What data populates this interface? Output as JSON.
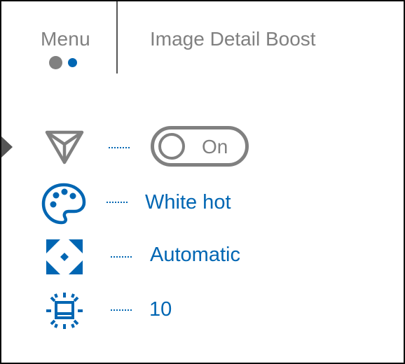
{
  "header": {
    "menu_label": "Menu",
    "title": "Image Detail Boost",
    "page_dots": {
      "active_index": 1,
      "count": 2
    }
  },
  "colors": {
    "accent": "#0066b3",
    "text_gray": "#808080",
    "dot_inactive": "#808080",
    "dot_active": "#0066b3",
    "pointer": "#555555",
    "border": "#0a0a0a"
  },
  "menu": {
    "selected_index": 0,
    "items": [
      {
        "icon": "detail-boost-icon",
        "control": "toggle",
        "value": "On",
        "state": true
      },
      {
        "icon": "palette-icon",
        "control": "value",
        "value": "White hot"
      },
      {
        "icon": "auto-focus-icon",
        "control": "value",
        "value": "Automatic"
      },
      {
        "icon": "brightness-icon",
        "control": "value",
        "value": "10"
      }
    ]
  }
}
